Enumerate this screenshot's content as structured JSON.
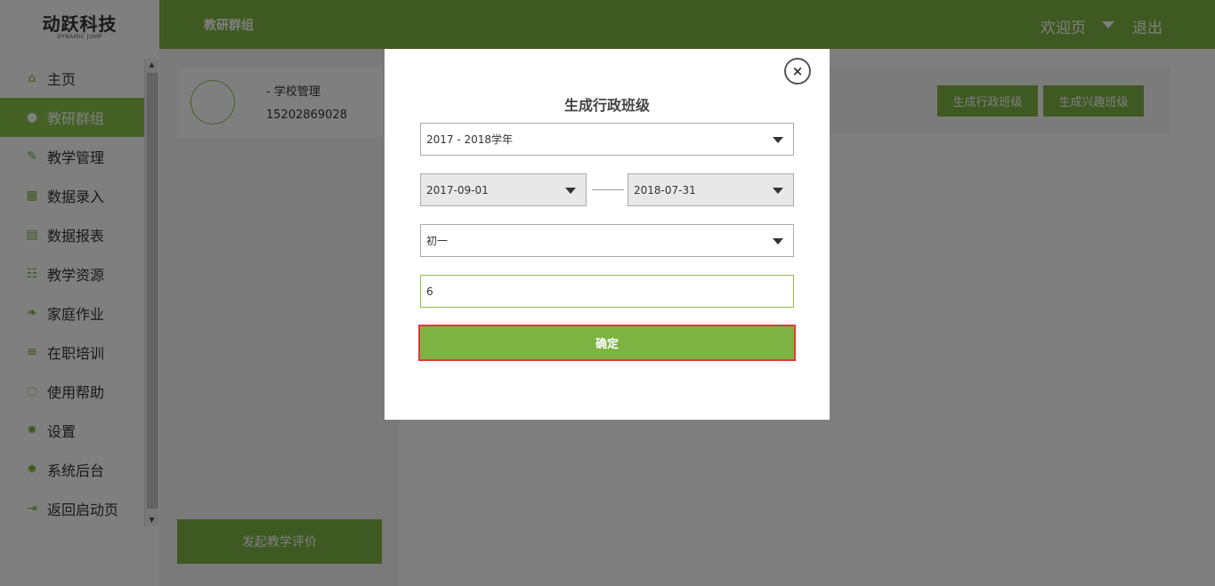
{
  "logo": {
    "main": "动跃科技",
    "sub": "DYNAMIC JUMP"
  },
  "header": {
    "title": "教研群组",
    "welcome": "欢迎页",
    "logout": "退出"
  },
  "sidebar": {
    "items": [
      {
        "label": "主页",
        "icon": "⌂"
      },
      {
        "label": "教研群组",
        "icon": "●"
      },
      {
        "label": "教学管理",
        "icon": "✎"
      },
      {
        "label": "数据录入",
        "icon": "▦"
      },
      {
        "label": "数据报表",
        "icon": "▤"
      },
      {
        "label": "教学资源",
        "icon": "☷"
      },
      {
        "label": "家庭作业",
        "icon": "❧"
      },
      {
        "label": "在职培训",
        "icon": "≡"
      },
      {
        "label": "使用帮助",
        "icon": "◌"
      },
      {
        "label": "设置",
        "icon": "✹"
      },
      {
        "label": "系统后台",
        "icon": "✹"
      },
      {
        "label": "返回启动页",
        "icon": "⇥"
      }
    ],
    "active_index": 1
  },
  "profile": {
    "name": "- 学校管理",
    "phone": "15202869028"
  },
  "left_panel": {
    "eval_button": "发起教学评价"
  },
  "toolbar": {
    "admin_class_button": "生成行政班级",
    "interest_class_button": "生成兴趣班级"
  },
  "modal": {
    "title": "生成行政班级",
    "close": "×",
    "school_year": "2017 - 2018学年",
    "start_date": "2017-09-01",
    "end_date": "2018-07-31",
    "grade": "初一",
    "count_value": "6",
    "confirm": "确定"
  },
  "colors": {
    "brand": "#7cb342",
    "highlight_border": "#e53935"
  }
}
